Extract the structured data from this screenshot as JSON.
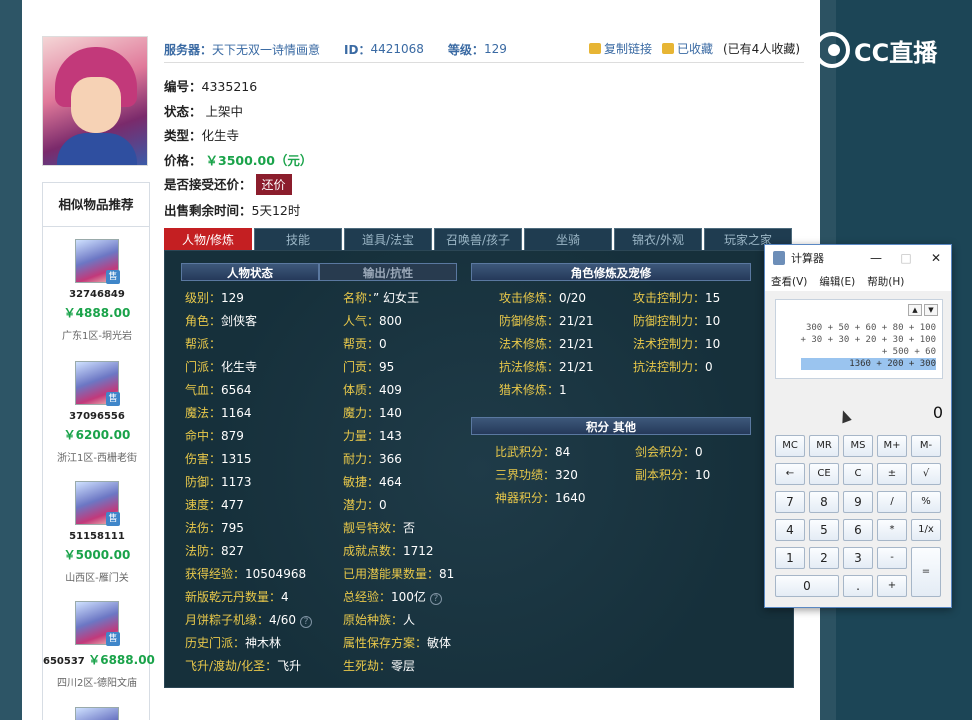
{
  "header": {
    "server_label": "服务器：",
    "server_value": "天下无双一诗情画意",
    "id_label": "ID：",
    "id_value": "4421068",
    "level_label": "等级：",
    "level_value": "129",
    "copy_link": "复制链接",
    "favorited": "已收藏",
    "fav_count": "(已有4人收藏)"
  },
  "item_info": {
    "number_label": "编号：",
    "number_value": "4335216",
    "status_label": "状态：",
    "status_value": "上架中",
    "type_label": "类型：",
    "type_value": "化生寺",
    "price_label": "价格：",
    "price_value": "￥3500.00（元）",
    "counter_label": "是否接受还价：",
    "counter_button": "还价",
    "time_label": "出售剩余时间：",
    "time_value": "5天12时"
  },
  "recommend": {
    "title": "相似物品推荐",
    "items": [
      {
        "id": "32746849",
        "price": "￥4888.00",
        "server": "广东1区-坰光岩"
      },
      {
        "id": "37096556",
        "price": "￥6200.00",
        "server": "浙江1区-西栅老街"
      },
      {
        "id": "51158111",
        "price": "￥5000.00",
        "server": "山西区-雁门关"
      },
      {
        "id": "650537",
        "price": "￥6888.00",
        "server": "四川2区-德阳文庙"
      }
    ],
    "tag": "售"
  },
  "tabs": [
    "人物/修炼",
    "技能",
    "道具/法宝",
    "召唤兽/孩子",
    "坐骑",
    "锦衣/外观",
    "玩家之家"
  ],
  "panel": {
    "bar_status": "人物状态",
    "bar_output": "输出/抗性",
    "bar_cultivation": "角色修炼及宠修",
    "bar_points": "积分  其他",
    "left_col": [
      {
        "k": "级别：",
        "v": "129"
      },
      {
        "k": "角色：",
        "v": "剑侠客"
      },
      {
        "k": "帮派：",
        "v": ""
      },
      {
        "k": "门派：",
        "v": "化生寺"
      },
      {
        "k": "气血：",
        "v": "6564"
      },
      {
        "k": "魔法：",
        "v": "1164"
      },
      {
        "k": "命中：",
        "v": "879"
      },
      {
        "k": "伤害：",
        "v": "1315"
      },
      {
        "k": "防御：",
        "v": "1173"
      },
      {
        "k": "速度：",
        "v": "477"
      },
      {
        "k": "法伤：",
        "v": "795"
      },
      {
        "k": "法防：",
        "v": "827"
      },
      {
        "k": "获得经验：",
        "v": "10504968"
      },
      {
        "k": "新版乾元丹数量：",
        "v": "4"
      },
      {
        "k": "月饼粽子机缘：",
        "v": "4/60"
      },
      {
        "k": "历史门派：",
        "v": "神木林"
      },
      {
        "k": "飞升/渡劫/化圣：",
        "v": "飞升"
      }
    ],
    "mid_col": [
      {
        "k": "名称：",
        "v": "” 幻女王"
      },
      {
        "k": "人气：",
        "v": "800"
      },
      {
        "k": "帮贡：",
        "v": "0"
      },
      {
        "k": "门贡：",
        "v": "95"
      },
      {
        "k": "体质：",
        "v": "409"
      },
      {
        "k": "魔力：",
        "v": "140"
      },
      {
        "k": "力量：",
        "v": "143"
      },
      {
        "k": "耐力：",
        "v": "366"
      },
      {
        "k": "敏捷：",
        "v": "464"
      },
      {
        "k": "潜力：",
        "v": "0"
      },
      {
        "k": "靓号特效：",
        "v": "否"
      },
      {
        "k": "成就点数：",
        "v": "1712"
      },
      {
        "k": "已用潜能果数量：",
        "v": "81"
      },
      {
        "k": "总经验：",
        "v": "100亿"
      },
      {
        "k": "原始种族：",
        "v": "人"
      },
      {
        "k": "属性保存方案：",
        "v": "敏体"
      },
      {
        "k": "生死劫：",
        "v": "零层"
      }
    ],
    "cultivation": [
      {
        "k": "攻击修炼：",
        "v": "0/20",
        "k2": "攻击控制力：",
        "v2": "15"
      },
      {
        "k": "防御修炼：",
        "v": "21/21",
        "k2": "防御控制力：",
        "v2": "10"
      },
      {
        "k": "法术修炼：",
        "v": "21/21",
        "k2": "法术控制力：",
        "v2": "10"
      },
      {
        "k": "抗法修炼：",
        "v": "21/21",
        "k2": "抗法控制力：",
        "v2": "0"
      },
      {
        "k": "猎术修炼：",
        "v": "1",
        "k2": "",
        "v2": ""
      }
    ],
    "points": [
      {
        "k": "比武积分：",
        "v": "84",
        "k2": "剑会积分：",
        "v2": "0"
      },
      {
        "k": "三界功绩：",
        "v": "320",
        "k2": "副本积分：",
        "v2": "10"
      },
      {
        "k": "神器积分：",
        "v": "1640",
        "k2": "",
        "v2": ""
      }
    ]
  },
  "calculator": {
    "title": "计算器",
    "menu": [
      "查看(V)",
      "编辑(E)",
      "帮助(H)"
    ],
    "history": [
      "300 + 50 + 60 + 80 + 100",
      "+ 30 + 30 + 20 + 30 + 100",
      "+ 500 + 60",
      "1360 + 200 + 300"
    ],
    "current": "0",
    "keys": [
      [
        "MC",
        "MR",
        "MS",
        "M+",
        "M-"
      ],
      [
        "←",
        "CE",
        "C",
        "±",
        "√"
      ],
      [
        "7",
        "8",
        "9",
        "/",
        "%"
      ],
      [
        "4",
        "5",
        "6",
        "*",
        "1/x"
      ],
      [
        "1",
        "2",
        "3",
        "-",
        "="
      ],
      [
        "0",
        ".",
        "+"
      ]
    ]
  },
  "logo_text": "CC直播"
}
